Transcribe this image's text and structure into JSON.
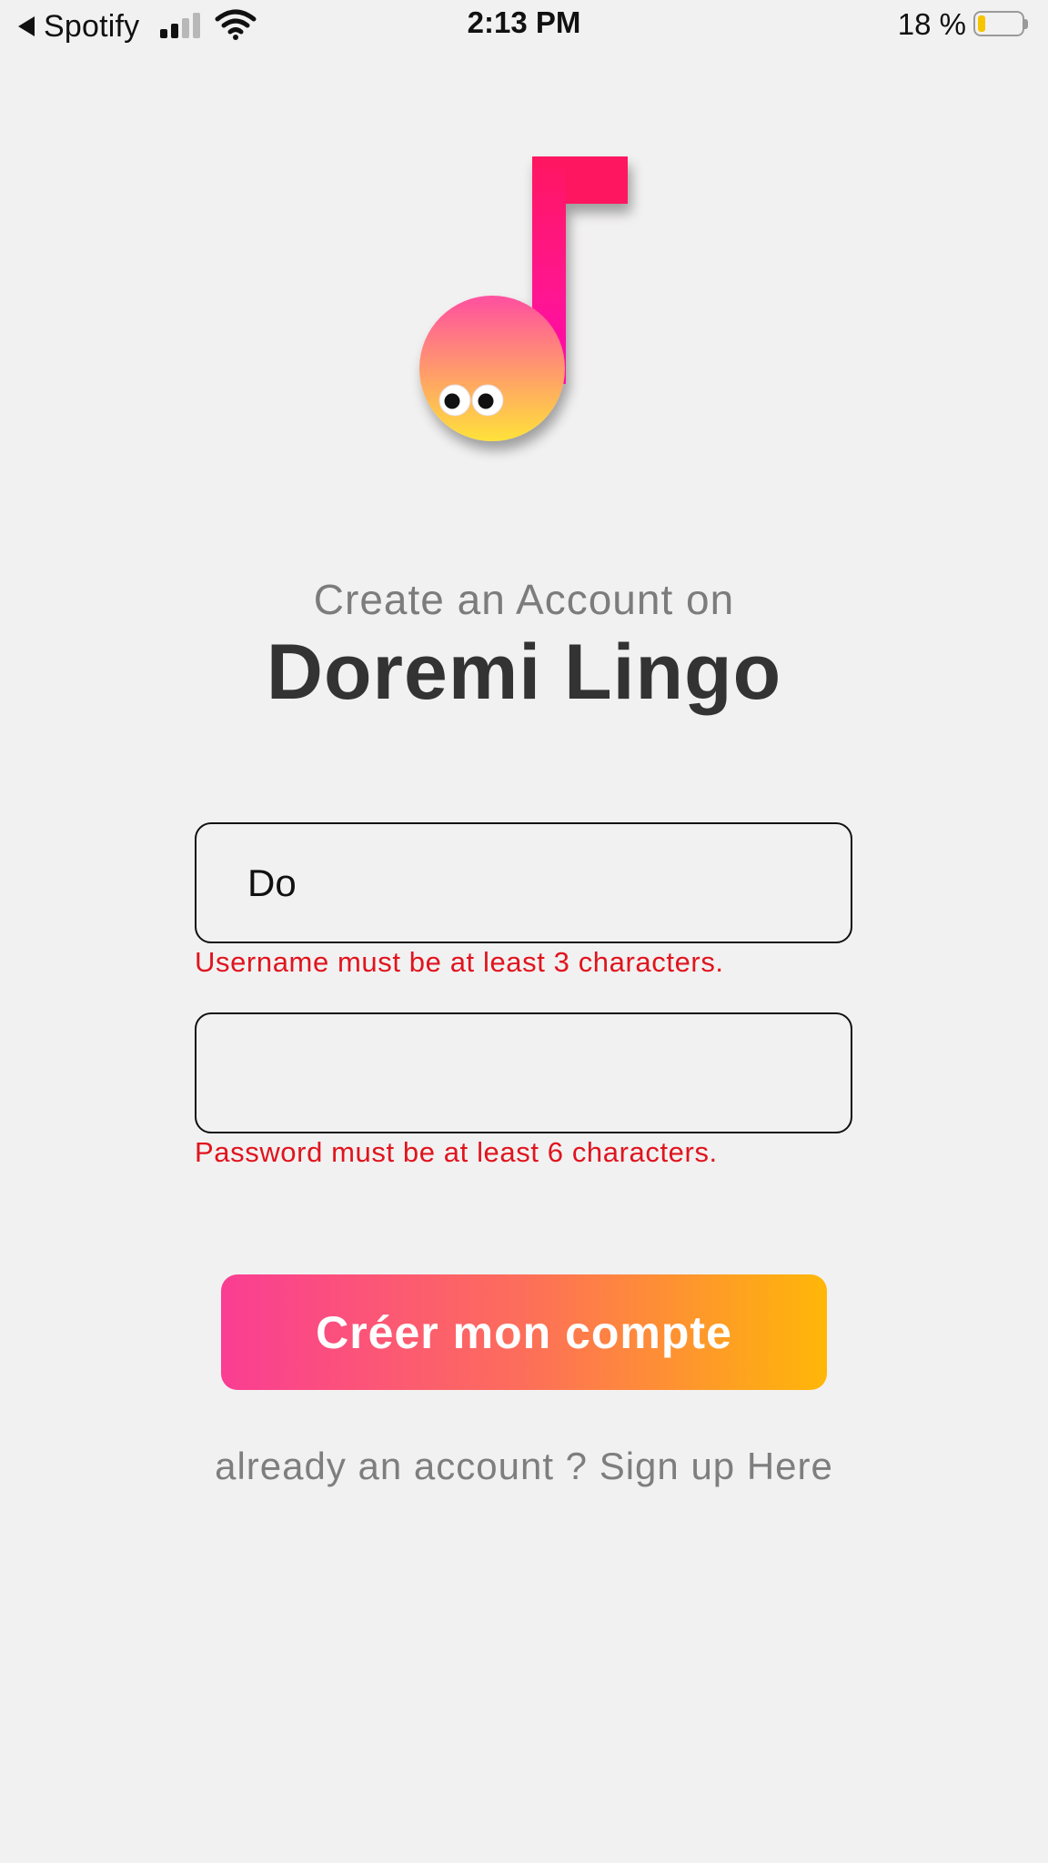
{
  "status_bar": {
    "back_app": "Spotify",
    "time": "2:13 PM",
    "battery_percent": "18 %",
    "battery_level": 0.18,
    "signal_bars_active": 2,
    "signal_bars_total": 4
  },
  "header": {
    "subtitle": "Create an Account on",
    "title": "Doremi Lingo"
  },
  "form": {
    "username_value": "Do",
    "username_error": "Username must be at least 3 characters.",
    "password_value": "",
    "password_error": "Password must be at least 6 characters.",
    "submit_label": "Créer mon compte"
  },
  "footer": {
    "signin_link": "already an account ? Sign up Here"
  },
  "colors": {
    "background": "#f2f1f1",
    "error": "#e0141e",
    "button_gradient_start": "#fa3d93",
    "button_gradient_mid": "#fd6e5a",
    "button_gradient_end": "#ffb708",
    "battery_fill": "#f7c400",
    "logo_top": "#ff1560",
    "logo_mid": "#ff4fa0",
    "logo_bottom": "#ffe23a"
  },
  "icons": {
    "back": "back-arrow-icon",
    "signal": "cellular-signal-icon",
    "wifi": "wifi-icon",
    "battery": "battery-icon",
    "logo": "music-note-mascot-logo"
  }
}
